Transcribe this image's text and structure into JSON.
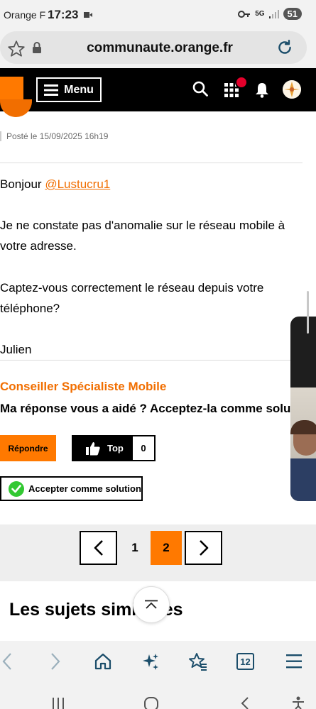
{
  "status_bar": {
    "carrier": "Orange F",
    "time": "17:23",
    "network": "5G",
    "battery": "51"
  },
  "browser": {
    "url": "communaute.orange.fr",
    "tab_count": "12"
  },
  "header": {
    "menu_label": "Menu"
  },
  "post": {
    "posted_label": "Posté le 15/09/2025 16h19",
    "greeting": "Bonjour ",
    "mention": "@Lustucru1",
    "paragraph1": "Je ne constate pas d'anomalie sur le réseau mobile à votre adresse.",
    "paragraph2": "Captez-vous correctement le réseau depuis votre téléphone?",
    "signature": "Julien",
    "author_role": "Conseiller Spécialiste Mobile",
    "helped_prompt": "Ma réponse vous a aidé ? Acceptez-la comme solution",
    "reply_label": "Répondre",
    "top_label": "Top",
    "top_count": "0",
    "accept_label": "Accepter comme solution"
  },
  "pagination": {
    "pages": [
      "1",
      "2"
    ],
    "current": "2"
  },
  "similar_topics_title": "Les sujets similaires",
  "colors": {
    "brand_orange": "#ff7900",
    "link_orange": "#f16e00",
    "header_black": "#000000"
  }
}
